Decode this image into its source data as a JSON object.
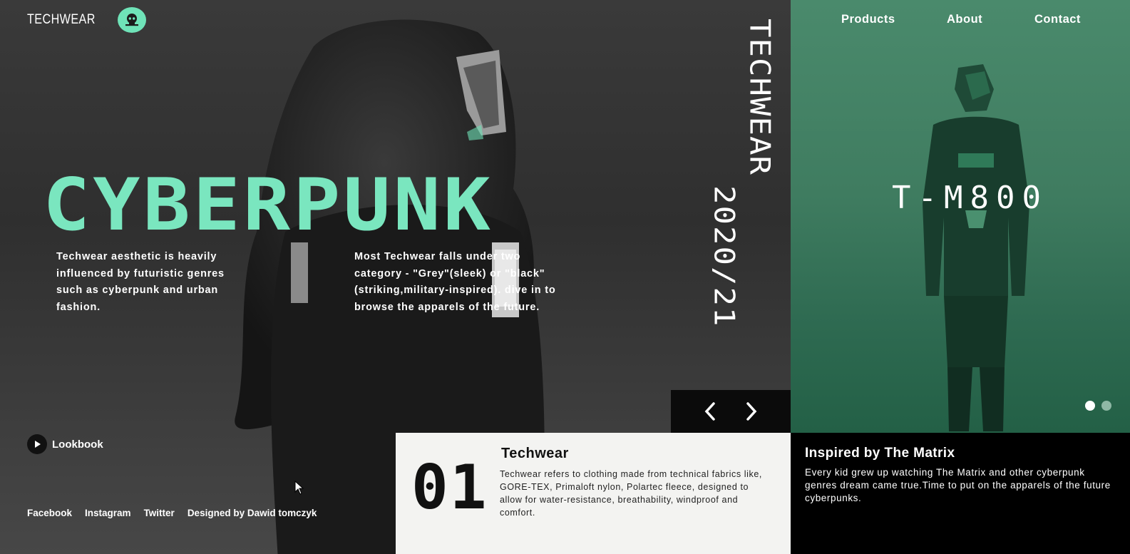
{
  "brand": {
    "name": "TECHWEAR",
    "logo_icon": "skull-icon"
  },
  "colors": {
    "accent": "#7ae6bf",
    "panel_green": "#3f7c60",
    "card_bg": "#f3f3f1",
    "dark": "#0b0b0b"
  },
  "hero": {
    "headline": "CYBERPUNK",
    "paragraph_1": "Techwear aesthetic is heavily influenced by futuristic genres such as cyberpunk and urban fashion.",
    "paragraph_2": "Most Techwear falls under two category - \"Grey\"(sleek) or \"black\"(striking,military-inspired). dive in to browse the apparels of the future.",
    "vertical_title": "TECHWEAR",
    "vertical_season": "2020/21",
    "lookbook_label": "Lookbook"
  },
  "footer": {
    "links": [
      "Facebook",
      "Instagram",
      "Twitter",
      "Designed by Dawid tomczyk"
    ]
  },
  "slider": {
    "prev_icon": "chevron-left-icon",
    "next_icon": "chevron-right-icon"
  },
  "info_card": {
    "number": "01",
    "title": "Techwear",
    "text": "Techwear refers to clothing made from technical fabrics like, GORE-TEX, Primaloft nylon, Polartec fleece, designed to allow for water-resistance, breathability, windproof and comfort."
  },
  "nav": {
    "items": [
      "Products",
      "About",
      "Contact"
    ]
  },
  "right_panel": {
    "model_name": "T-M800",
    "title": "Inspired by The Matrix",
    "text": "Every kid grew up watching The Matrix and other cyberpunk genres dream came true.Time to put on the apparels of the future cyberpunks."
  }
}
